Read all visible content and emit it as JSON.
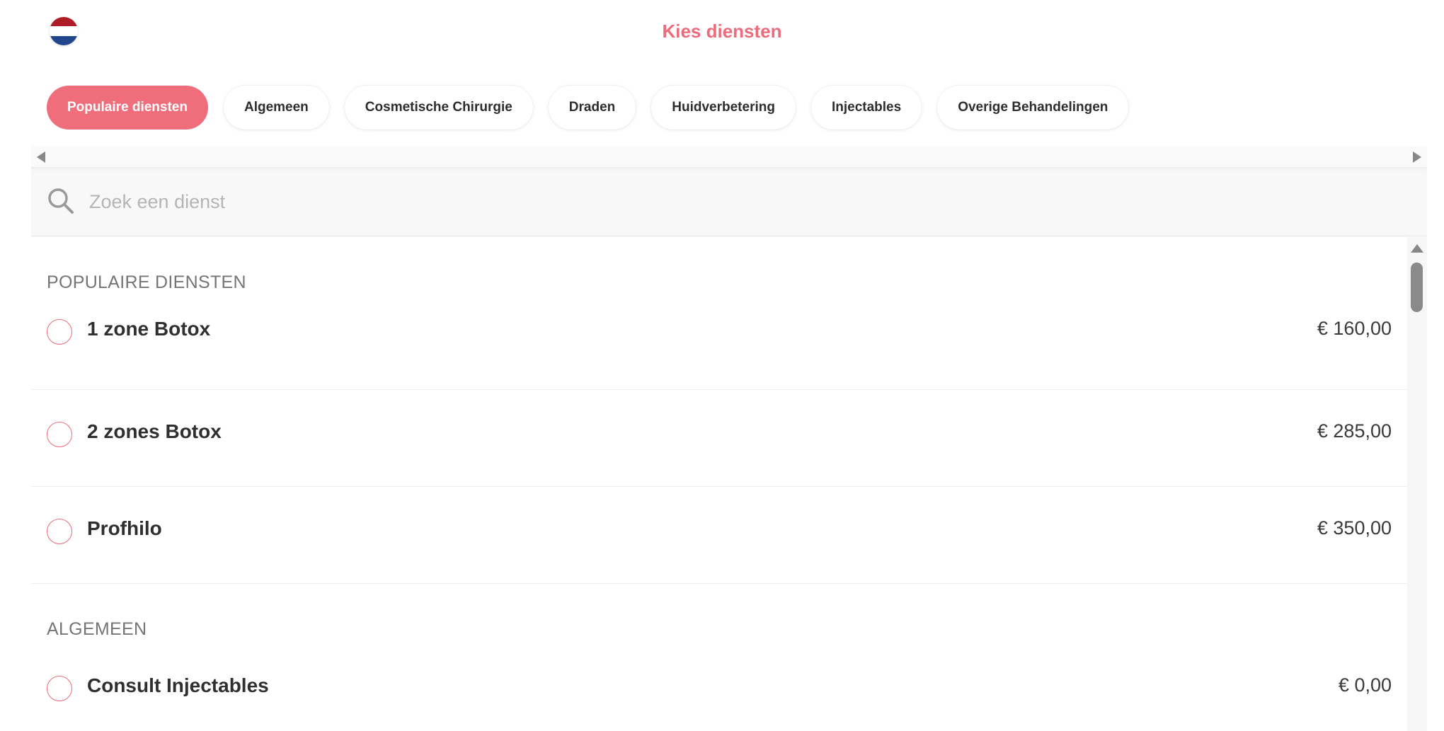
{
  "header": {
    "title": "Kies diensten",
    "language_flag": "nl-flag-icon"
  },
  "tabs": [
    {
      "label": "Populaire diensten",
      "active": true
    },
    {
      "label": "Algemeen",
      "active": false
    },
    {
      "label": "Cosmetische Chirurgie",
      "active": false
    },
    {
      "label": "Draden",
      "active": false
    },
    {
      "label": "Huidverbetering",
      "active": false
    },
    {
      "label": "Injectables",
      "active": false
    },
    {
      "label": "Overige Behandelingen",
      "active": false
    }
  ],
  "search": {
    "placeholder": "Zoek een dienst",
    "value": "",
    "icon": "search-icon"
  },
  "sections": [
    {
      "title": "POPULAIRE DIENSTEN",
      "items": [
        {
          "name": "1 zone Botox",
          "price": "€ 160,00",
          "selected": false
        },
        {
          "name": "2 zones Botox",
          "price": "€ 285,00",
          "selected": false
        },
        {
          "name": "Profhilo",
          "price": "€ 350,00",
          "selected": false
        }
      ]
    },
    {
      "title": "ALGEMEEN",
      "items": [
        {
          "name": "Consult Injectables",
          "price": "€ 0,00",
          "selected": false
        }
      ]
    }
  ],
  "colors": {
    "accent": "#f06e7c",
    "title": "#ee6b7b",
    "radio_border": "#ee6b7b"
  }
}
